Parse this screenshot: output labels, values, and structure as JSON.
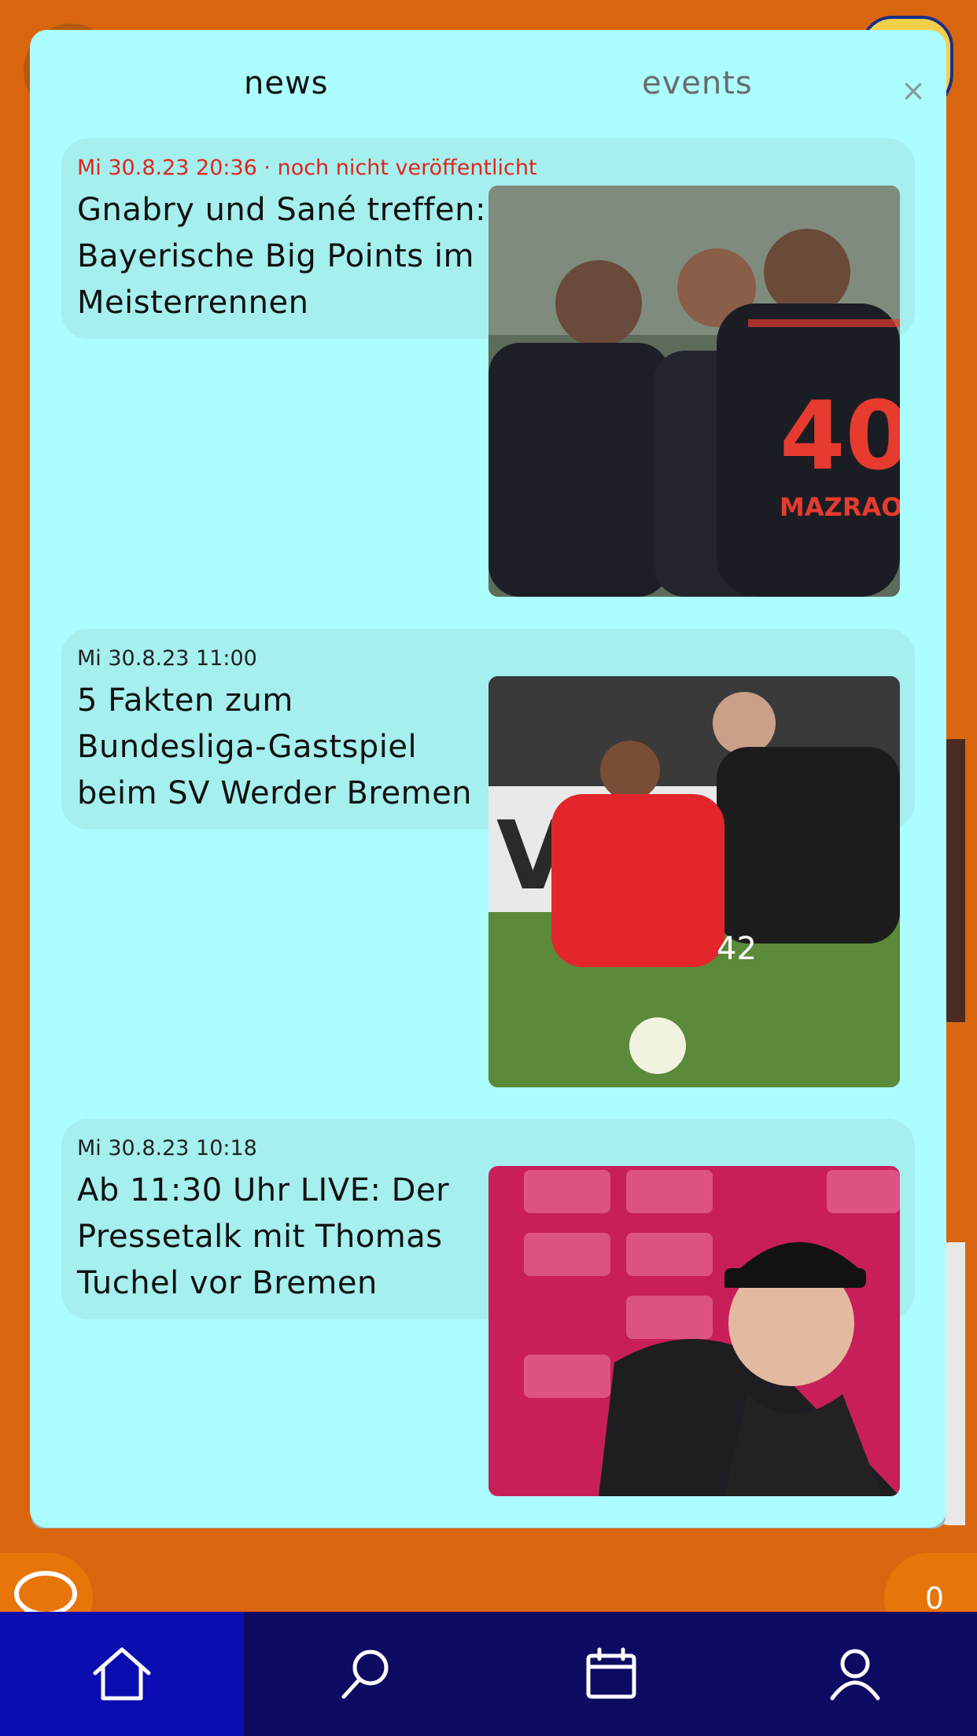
{
  "modal": {
    "tabs": [
      {
        "label": "news",
        "active": true
      },
      {
        "label": "events",
        "active": false
      }
    ],
    "close_label": "×"
  },
  "news": [
    {
      "date": "Mi 30.8.23 20:36 · noch nicht veröffentlicht",
      "unpublished": true,
      "title": "Gnabry und Sané treffen: Bayerische Big Points im Meisterrennen"
    },
    {
      "date": "Mi 30.8.23 11:00",
      "unpublished": false,
      "title": "5 Fakten zum Bundesliga-Gastspiel beim SV Werder Bremen"
    },
    {
      "date": "Mi 30.8.23 10:18",
      "unpublished": false,
      "title": "Ab 11:30 Uhr LIVE: Der Pressetalk mit Thomas Tuchel vor Bremen"
    }
  ],
  "bottom": {
    "count": "0",
    "chat_icon": "chat-bubble-icon",
    "nav": [
      {
        "icon": "home-icon",
        "active": true
      },
      {
        "icon": "search-icon",
        "active": false
      },
      {
        "icon": "calendar-icon",
        "active": false
      },
      {
        "icon": "user-icon",
        "active": false
      }
    ]
  },
  "colors": {
    "background": "#d9660f",
    "modal": "#acfdfd",
    "card": "#a5efef",
    "unpublished": "#e0261b",
    "nav": "#0d0b62",
    "nav_active": "#0b0db0",
    "accent_button": "#e8750a"
  }
}
